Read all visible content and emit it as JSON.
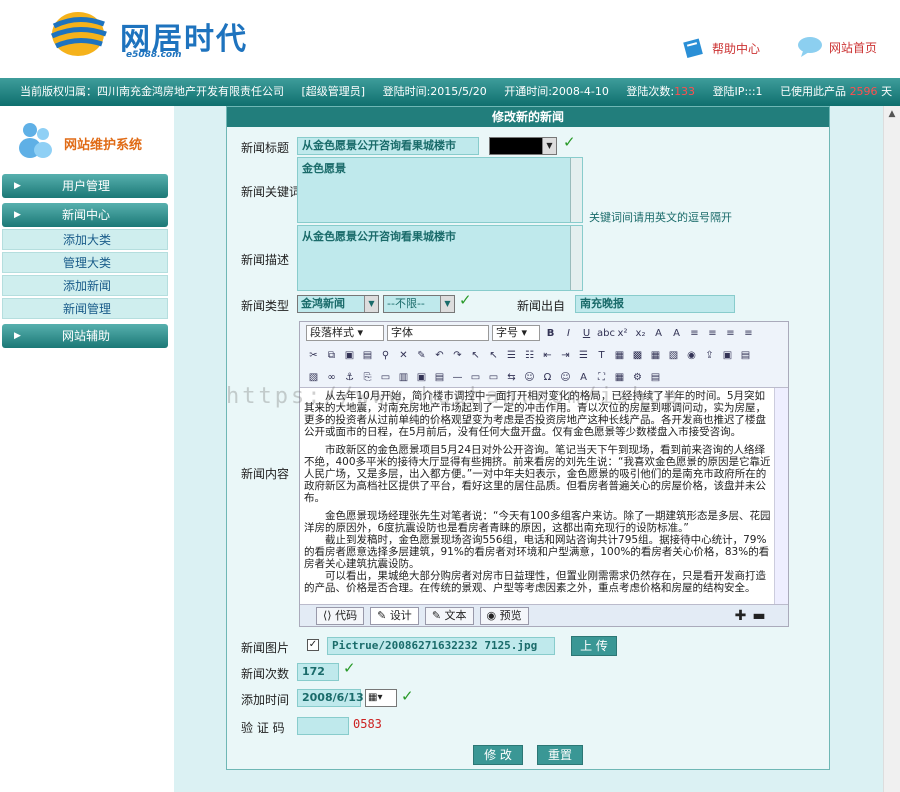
{
  "header": {
    "logo_text": "网居时代",
    "logo_sub": "e5088.com",
    "help": "帮助中心",
    "home": "网站首页"
  },
  "infobar": {
    "company": "当前版权归属：四川南充金鸿房地产开发有限责任公司",
    "role": "[超级管理员]",
    "login_time": "登陆时间:2015/5/20",
    "open_time": "开通时间:2008-4-10",
    "login_count_label": "登陆次数:",
    "login_count": "133",
    "login_ip": "登陆IP:::1",
    "product_label": "已使用此产品",
    "product_days": "2596",
    "product_unit": "天"
  },
  "sidebar": {
    "title": "网站维护系统",
    "items": [
      {
        "label": "用户管理"
      },
      {
        "label": "新闻中心"
      },
      {
        "label": "添加大类"
      },
      {
        "label": "管理大类"
      },
      {
        "label": "添加新闻"
      },
      {
        "label": "新闻管理"
      },
      {
        "label": "网站辅助"
      }
    ]
  },
  "form": {
    "title": "修改新的新闻",
    "labels": {
      "title": "新闻标题",
      "keywords": "新闻关键词",
      "desc": "新闻描述",
      "type": "新闻类型",
      "source": "新闻出自",
      "content": "新闻内容",
      "image": "新闻图片",
      "count": "新闻次数",
      "time": "添加时间",
      "code": "验 证 码"
    },
    "title_value": "从金色愿景公开咨询看果城楼市",
    "keywords_value": "金色愿景",
    "keywords_hint": "关键词间请用英文的逗号隔开",
    "desc_value": "从金色愿景公开咨询看果城楼市",
    "type_value": "金鸿新闻",
    "type_sub": "--不限--",
    "source_value": "南充晚报",
    "image_value": "Pictrue/20086271632232 7125.jpg",
    "upload_label": "上 传",
    "count_value": "172",
    "time_value": "2008/6/13",
    "code_text": "0583",
    "submit": "修 改",
    "reset": "重置"
  },
  "editor": {
    "toolbar": {
      "paragraph": "段落样式",
      "font": "字体",
      "size": "字号"
    },
    "tabs": {
      "code": "代码",
      "design": "设计",
      "text": "文本",
      "preview": "预览"
    },
    "content": [
      "从去年10月开始，简介楼市调控中一面打开相对变化的格局，已经持续了半年的时间。5月突如其来的大地震，对南充房地产市场起到了一定的冲击作用。青以次位的房屋到哪调问动，实为房屋，更多的投资者从过前单纯的价格观望变为考虑是否投资房地产这种长线产品。各开发商也推迟了楼盘公开或面市的日程，在5月前后，没有任何大盘开盘。仅有金色愿景等少数楼盘入市接受咨询。",
      "市政新区的金色愿景项目5月24日对外公开咨询。笔记当天下午到现场，看到前来咨询的人络绎不绝，400多平米的接待大厅显得有些拥挤。前来看房的刘先生说：“我喜欢金色愿景的原因是它靠近人民广场，又是多层，出入都方便。”一对中年夫妇表示，金色愿景的吸引他们的是南充市政府所在的政府新区为高档社区提供了平台，看好这里的居住品质。但看房者普遍关心的房屋价格，该盘并未公布。",
      "金色愿景现场经理张先生对笔者说：“今天有100多组客户来访。除了一期建筑形态是多层、花园洋房的原因外，6度抗震设防也是看房者青睐的原因，这都出南充现行的设防标准。”",
      "截止到发稿时，金色愿景现场咨询556组，电话和网站咨询共计795组。据接待中心统计，79%的看房者愿意选择多层建筑，91%的看房者对环境和户型满意，100%的看房者关心价格，83%的看房者关心建筑抗震设防。",
      "可以看出，果城绝大部分购房者对房市日益理性，但置业刚需需求仍然存在，只是看开发商打造的产品、价格是否合理。在传统的景观、户型等考虑因素之外，重点考虑价格和房屋的结构安全。"
    ]
  },
  "watermark": "https://www.huzhan.com/ishop"
}
